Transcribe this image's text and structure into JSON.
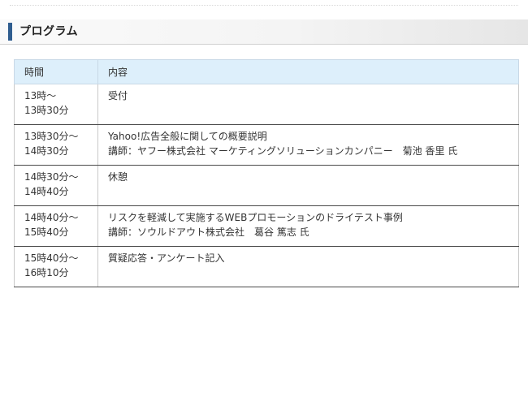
{
  "section": {
    "title": "プログラム"
  },
  "table": {
    "headers": {
      "time": "時間",
      "content": "内容"
    },
    "rows": [
      {
        "time_start": "13時～",
        "time_end": "13時30分",
        "title": "受付",
        "speaker": ""
      },
      {
        "time_start": "13時30分～",
        "time_end": "14時30分",
        "title": "Yahoo!広告全般に関しての概要説明",
        "speaker": "講師：ヤフー株式会社 マーケティングソリューションカンパニー　菊池 香里 氏"
      },
      {
        "time_start": "14時30分～",
        "time_end": "14時40分",
        "title": "休憩",
        "speaker": ""
      },
      {
        "time_start": "14時40分～",
        "time_end": "15時40分",
        "title": "リスクを軽減して実施するWEBプロモーションのドライテスト事例",
        "speaker": "講師：ソウルドアウト株式会社　葛谷 篤志 氏"
      },
      {
        "time_start": "15時40分～",
        "time_end": "16時10分",
        "title": "質疑応答・アンケート記入",
        "speaker": ""
      }
    ]
  },
  "colors": {
    "accent_bar": "#2f5d8f",
    "header_row_bg": "#ddeffb",
    "row_divider": "#4a4a4a"
  }
}
